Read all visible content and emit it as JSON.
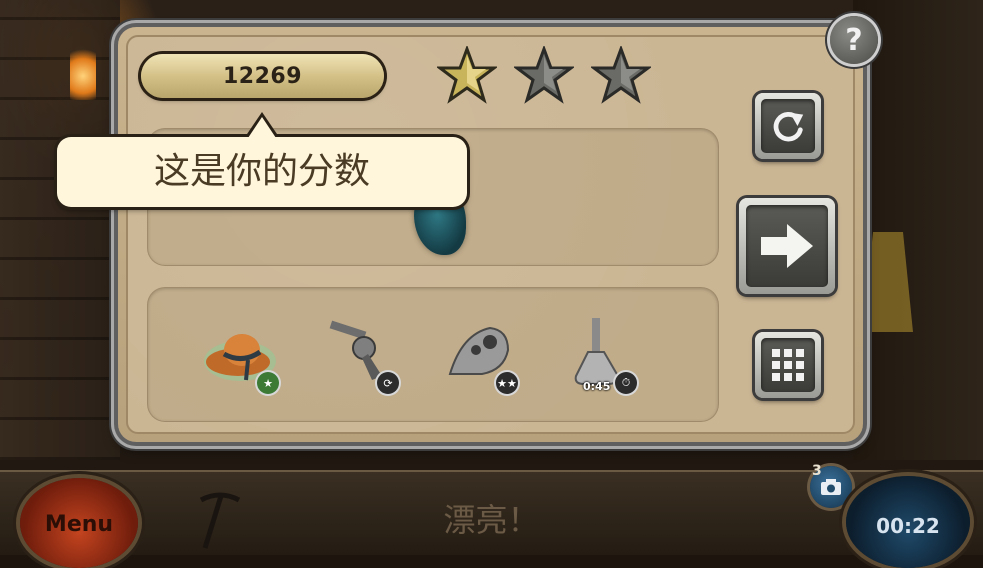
{
  "score": {
    "value": "12269"
  },
  "stars": {
    "earned": 1,
    "total": 3,
    "colors": {
      "earned": "#c8b45a",
      "empty": "#6a6a66"
    }
  },
  "tooltip": {
    "text": "这是你的分数"
  },
  "buttons": {
    "help_label": "?",
    "replay_icon": "refresh-icon",
    "next_icon": "arrow-right-icon",
    "level_select_icon": "grid-icon"
  },
  "items": [
    {
      "name": "hat",
      "badge_icon": "star-icon",
      "badge_color": "#3c7a36"
    },
    {
      "name": "revolver",
      "badge_icon": "refresh-icon",
      "badge_color": "#2c2c2c"
    },
    {
      "name": "plague-mask",
      "badge_icon": "stars-icon",
      "badge_color": "#2c2c2c"
    },
    {
      "name": "flask",
      "badge_icon": "stopwatch-icon",
      "badge_color": "#2c2c2c",
      "time": "0:45"
    }
  ],
  "hud": {
    "menu_label": "Menu",
    "message": "漂亮！",
    "timer": "00:22",
    "camera_count": "3"
  }
}
